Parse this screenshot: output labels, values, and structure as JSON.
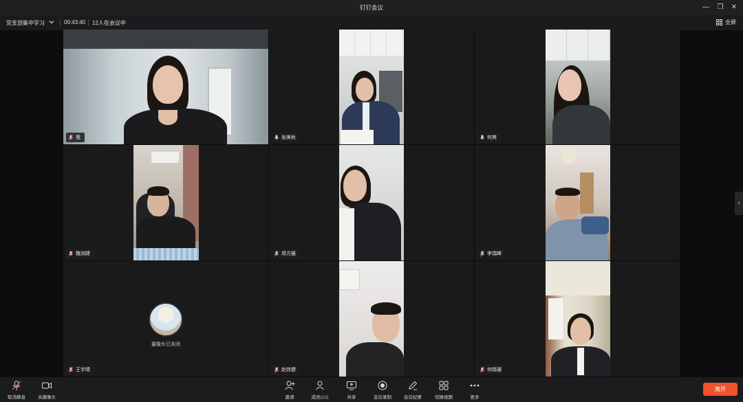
{
  "window": {
    "title": "钉钉会议"
  },
  "header": {
    "meeting_name": "党支部集中学习",
    "duration": "00:43:40",
    "participant_count_text": "12人在会议中",
    "fullscreen_label": "全屏"
  },
  "tiles": [
    {
      "name": "我"
    },
    {
      "name": "张美秋"
    },
    {
      "name": "何爽"
    },
    {
      "name": "魏润婕"
    },
    {
      "name": "郑方媛"
    },
    {
      "name": "李瑞峰"
    },
    {
      "name": "王宇晴",
      "camera_off_text": "摄像头已关闭"
    },
    {
      "name": "赵炜健"
    },
    {
      "name": "何晓珊"
    }
  ],
  "toolbar": {
    "unmute": "取消静音",
    "camera_off": "关摄像头",
    "invite": "邀请",
    "members": "成员(12)",
    "share": "共享",
    "record": "会议录制",
    "minutes": "会议纪要",
    "switch_view": "切换视图",
    "more": "更多",
    "leave": "离开"
  },
  "colors": {
    "leave": "#f3532b",
    "background": "#0d0d0e",
    "tile": "#1a1a1b"
  }
}
